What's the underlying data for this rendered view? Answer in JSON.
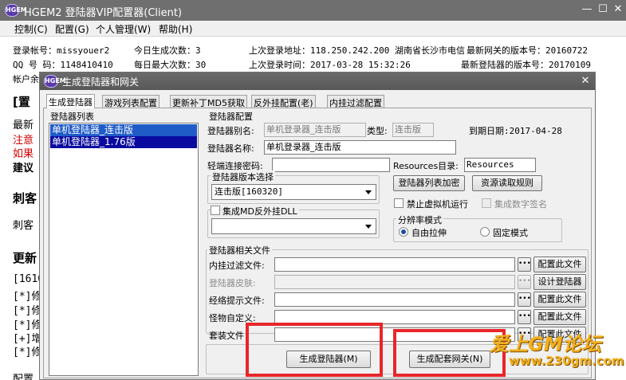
{
  "window": {
    "title": "HGEM2 登陆器VIP配置器(Client)",
    "icon_text": "HGEM",
    "controls": [
      "minimize-icon",
      "maximize-icon",
      "close-icon"
    ]
  },
  "menu": [
    "控制(C)",
    "配置(G)",
    "个人管理(W)",
    "帮助(H)"
  ],
  "info": {
    "account": "登录帐号：missyouer2",
    "qq": "QQ 号 码：1148410410",
    "today_gen": "今日生成次数：3",
    "max_gen": "每日最大次数：30",
    "last_addr": "上次登录地址：118.250.242.200 湖南省长沙市电信",
    "last_time": "上次登录时间：2017-03-28 15:32:26",
    "latest_net": "最新网关的版本号：20160722",
    "latest_launcher": "最新登陆器的版本号：20170109"
  },
  "background": {
    "row_partial": "帐户余",
    "lines": [
      "[置",
      "最新",
      "注意",
      "如果",
      "建议",
      "刺客",
      "刺客",
      "更新",
      "[1610",
      "[*]修",
      "[*]修",
      "[*]修",
      "[+]增",
      "[*]修",
      "配置"
    ]
  },
  "dialog": {
    "title": "生成登陆器和网关",
    "icon_text": "HGEM",
    "tabs": [
      "生成登陆器",
      "游戏列表配置",
      "更新补丁MD5获取",
      "反外挂配置(老)",
      "内挂过滤配置"
    ],
    "launcher_list": {
      "label": "登陆器列表",
      "items": [
        "单机登陆器_连击版",
        "单机登陆器_1.76版"
      ]
    },
    "config": {
      "label": "登陆器配置",
      "alias_label": "登陆器别名:",
      "alias_value": "单机登录器_连击版",
      "type_label": "类型:",
      "type_value": "连击版",
      "expire": "到期日期:2017-04-28",
      "name_label": "登陆器名称:",
      "name_value": "单机登录器_连击版",
      "password_label": "轻端连接密码:",
      "password_value": "",
      "resources_label": "Resources目录:",
      "resources_value": "Resources",
      "version_group_label": "登陆器版本选择",
      "version_value": "连击版[160320]",
      "encrypt_btn": "登陆器列表加密",
      "resource_rule_btn": "资源读取规则",
      "no_vm_label": "禁止虚拟机运行",
      "digital_sign_label": "集成数字签名",
      "md_dll_label": "集成MD反外挂DLL",
      "md_dll_value": "",
      "resolution_label": "分辨率模式",
      "resolution_options": [
        "自由拉伸",
        "固定模式"
      ],
      "resolution_selected": "自由拉伸"
    },
    "files": {
      "label": "登陆器相关文件",
      "rows": [
        {
          "label": "内挂过滤文件:",
          "value": "",
          "button": "配置此文件",
          "disabled": false
        },
        {
          "label": "登陆器皮肤:",
          "value": "",
          "button": "设计登陆器",
          "disabled": true
        },
        {
          "label": "经络提示文件:",
          "value": "",
          "button": "配置此文件",
          "disabled": false
        },
        {
          "label": "怪物自定义:",
          "value": "",
          "button": "配置此文件",
          "disabled": false
        },
        {
          "label": "套装文件",
          "value": "",
          "button": "配置此文件",
          "disabled": false
        }
      ],
      "dots": "•••"
    },
    "gen_launcher_btn": "生成登陆器(M)",
    "gen_gateway_btn": "生成配套网关(N)"
  },
  "watermark": {
    "line1": "爱上GM论坛",
    "line2": "www.230gm.com"
  },
  "colors": {
    "titlebar": "#6f6f6f",
    "list_selection": "#0a0aa0",
    "highlight_box": "#e8262a",
    "watermark": "#f2b01e",
    "warning_text": "#d40000"
  }
}
